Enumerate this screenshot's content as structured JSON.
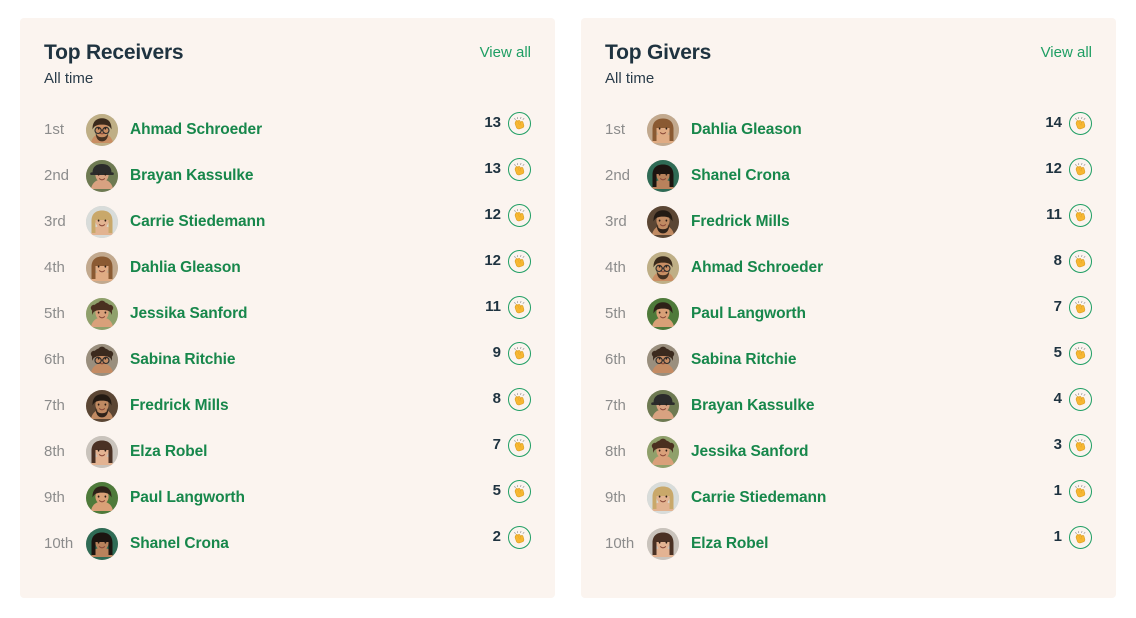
{
  "theme": {
    "page_background": "#FFFFFF",
    "card_background": "#FBF4EF",
    "title_color": "#1F3340",
    "link_green": "#1E9E63",
    "name_green": "#17874B",
    "rank_grey": "#8C8C8C",
    "badge_icon": "clapping-hands-icon"
  },
  "panels": [
    {
      "title": "Top Receivers",
      "subtitle": "All time",
      "view_all_label": "View all",
      "rows": [
        {
          "rank": "1st",
          "name": "Ahmad Schroeder",
          "count": "13",
          "avatar": "ahmad-schroeder"
        },
        {
          "rank": "2nd",
          "name": "Brayan Kassulke",
          "count": "13",
          "avatar": "brayan-kassulke"
        },
        {
          "rank": "3rd",
          "name": "Carrie Stiedemann",
          "count": "12",
          "avatar": "carrie-stiedemann"
        },
        {
          "rank": "4th",
          "name": "Dahlia Gleason",
          "count": "12",
          "avatar": "dahlia-gleason"
        },
        {
          "rank": "5th",
          "name": "Jessika Sanford",
          "count": "11",
          "avatar": "jessika-sanford"
        },
        {
          "rank": "6th",
          "name": "Sabina Ritchie",
          "count": "9",
          "avatar": "sabina-ritchie"
        },
        {
          "rank": "7th",
          "name": "Fredrick Mills",
          "count": "8",
          "avatar": "fredrick-mills"
        },
        {
          "rank": "8th",
          "name": "Elza Robel",
          "count": "7",
          "avatar": "elza-robel"
        },
        {
          "rank": "9th",
          "name": "Paul Langworth",
          "count": "5",
          "avatar": "paul-langworth"
        },
        {
          "rank": "10th",
          "name": "Shanel Crona",
          "count": "2",
          "avatar": "shanel-crona"
        }
      ]
    },
    {
      "title": "Top Givers",
      "subtitle": "All time",
      "view_all_label": "View all",
      "rows": [
        {
          "rank": "1st",
          "name": "Dahlia Gleason",
          "count": "14",
          "avatar": "dahlia-gleason"
        },
        {
          "rank": "2nd",
          "name": "Shanel Crona",
          "count": "12",
          "avatar": "shanel-crona"
        },
        {
          "rank": "3rd",
          "name": "Fredrick Mills",
          "count": "11",
          "avatar": "fredrick-mills"
        },
        {
          "rank": "4th",
          "name": "Ahmad Schroeder",
          "count": "8",
          "avatar": "ahmad-schroeder"
        },
        {
          "rank": "5th",
          "name": "Paul Langworth",
          "count": "7",
          "avatar": "paul-langworth"
        },
        {
          "rank": "6th",
          "name": "Sabina Ritchie",
          "count": "5",
          "avatar": "sabina-ritchie"
        },
        {
          "rank": "7th",
          "name": "Brayan Kassulke",
          "count": "4",
          "avatar": "brayan-kassulke"
        },
        {
          "rank": "8th",
          "name": "Jessika Sanford",
          "count": "3",
          "avatar": "jessika-sanford"
        },
        {
          "rank": "9th",
          "name": "Carrie Stiedemann",
          "count": "1",
          "avatar": "carrie-stiedemann"
        },
        {
          "rank": "10th",
          "name": "Elza Robel",
          "count": "1",
          "avatar": "elza-robel"
        }
      ]
    }
  ]
}
